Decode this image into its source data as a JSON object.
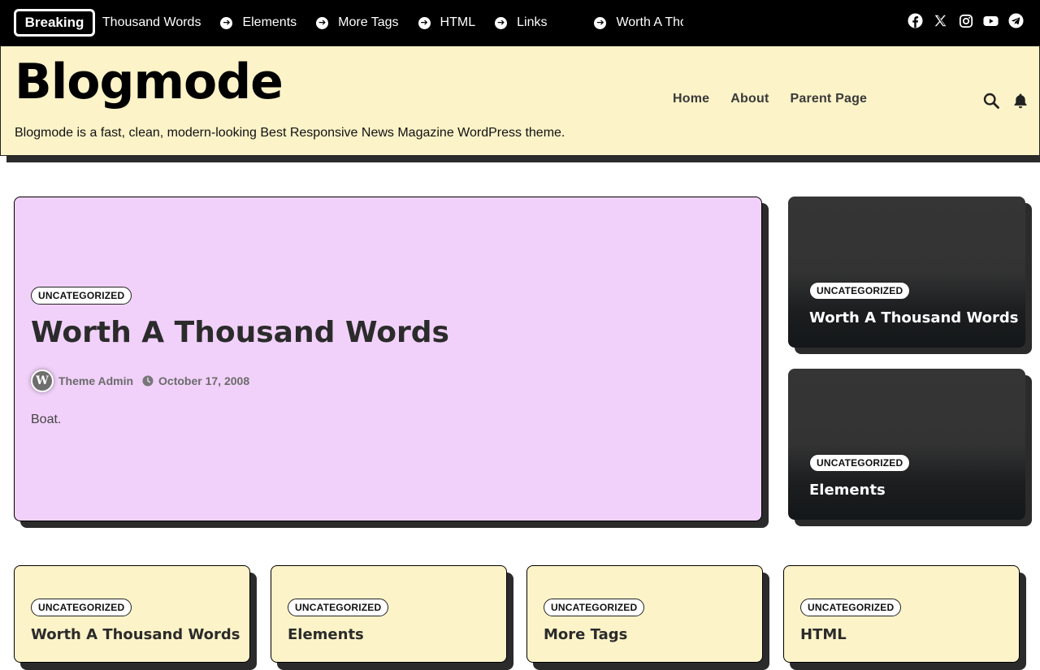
{
  "topbar": {
    "breaking_label": "Breaking",
    "ticker": [
      "Worth A Thousand Words",
      "Elements",
      "More Tags",
      "HTML",
      "Links",
      "Worth A Thousand Words"
    ],
    "social": [
      "facebook-icon",
      "x-icon",
      "instagram-icon",
      "youtube-icon",
      "telegram-icon"
    ]
  },
  "header": {
    "site_title": "Blogmode",
    "tagline": "Blogmode is a fast, clean, modern-looking Best Responsive News Magazine WordPress theme.",
    "nav": [
      "Home",
      "About",
      "Parent Page"
    ],
    "background": "#fcf3c8"
  },
  "hero": {
    "category": "UNCATEGORIZED",
    "title": "Worth A Thousand Words",
    "author": "Theme Admin",
    "date": "October 17, 2008",
    "excerpt": "Boat.",
    "background": "#f1d1f9"
  },
  "side_cards": [
    {
      "category": "UNCATEGORIZED",
      "title": "Worth A Thousand Words"
    },
    {
      "category": "UNCATEGORIZED",
      "title": "Elements"
    }
  ],
  "bottom_cards": [
    {
      "category": "UNCATEGORIZED",
      "title": "Worth A Thousand Words"
    },
    {
      "category": "UNCATEGORIZED",
      "title": "Elements"
    },
    {
      "category": "UNCATEGORIZED",
      "title": "More Tags"
    },
    {
      "category": "UNCATEGORIZED",
      "title": "HTML"
    }
  ]
}
